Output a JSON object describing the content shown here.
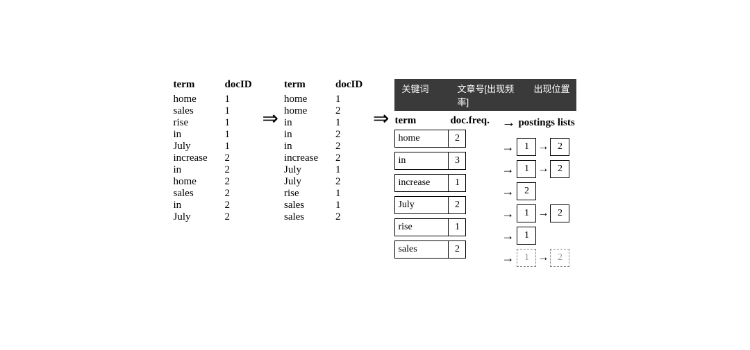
{
  "left_table": {
    "headers": [
      "term",
      "docID"
    ],
    "rows": [
      [
        "home",
        "1"
      ],
      [
        "sales",
        "1"
      ],
      [
        "rise",
        "1"
      ],
      [
        "in",
        "1"
      ],
      [
        "July",
        "1"
      ],
      [
        "increase",
        "2"
      ],
      [
        "in",
        "2"
      ],
      [
        "home",
        "2"
      ],
      [
        "sales",
        "2"
      ],
      [
        "in",
        "2"
      ],
      [
        "July",
        "2"
      ]
    ]
  },
  "mid_table": {
    "headers": [
      "term",
      "docID"
    ],
    "rows": [
      [
        "home",
        "1"
      ],
      [
        "home",
        "2"
      ],
      [
        "in",
        "1"
      ],
      [
        "in",
        "2"
      ],
      [
        "in",
        "2"
      ],
      [
        "increase",
        "2"
      ],
      [
        "July",
        "1"
      ],
      [
        "July",
        "2"
      ],
      [
        "rise",
        "1"
      ],
      [
        "sales",
        "1"
      ],
      [
        "sales",
        "2"
      ]
    ]
  },
  "chinese_header": {
    "keyword": "关键词",
    "freq": "文章号[出现频率]",
    "pos": "出现位置"
  },
  "inv_table": {
    "term_header": "term",
    "freq_header": "doc.freq.",
    "rows": [
      {
        "term": "home",
        "freq": "2"
      },
      {
        "term": "in",
        "freq": "3"
      },
      {
        "term": "increase",
        "freq": "1"
      },
      {
        "term": "July",
        "freq": "2"
      },
      {
        "term": "rise",
        "freq": "1"
      },
      {
        "term": "sales",
        "freq": "2"
      }
    ]
  },
  "postings": {
    "header": "postings lists",
    "rows": [
      [
        {
          "val": "1",
          "dashed": false
        },
        {
          "val": "2",
          "dashed": false
        }
      ],
      [
        {
          "val": "1",
          "dashed": false
        },
        {
          "val": "2",
          "dashed": false
        }
      ],
      [
        {
          "val": "2",
          "dashed": false
        }
      ],
      [
        {
          "val": "1",
          "dashed": false
        },
        {
          "val": "2",
          "dashed": false
        }
      ],
      [
        {
          "val": "1",
          "dashed": false
        }
      ],
      [
        {
          "val": "1",
          "dashed": true
        },
        {
          "val": "2",
          "dashed": true
        }
      ]
    ]
  },
  "arrow_label": "⇒"
}
